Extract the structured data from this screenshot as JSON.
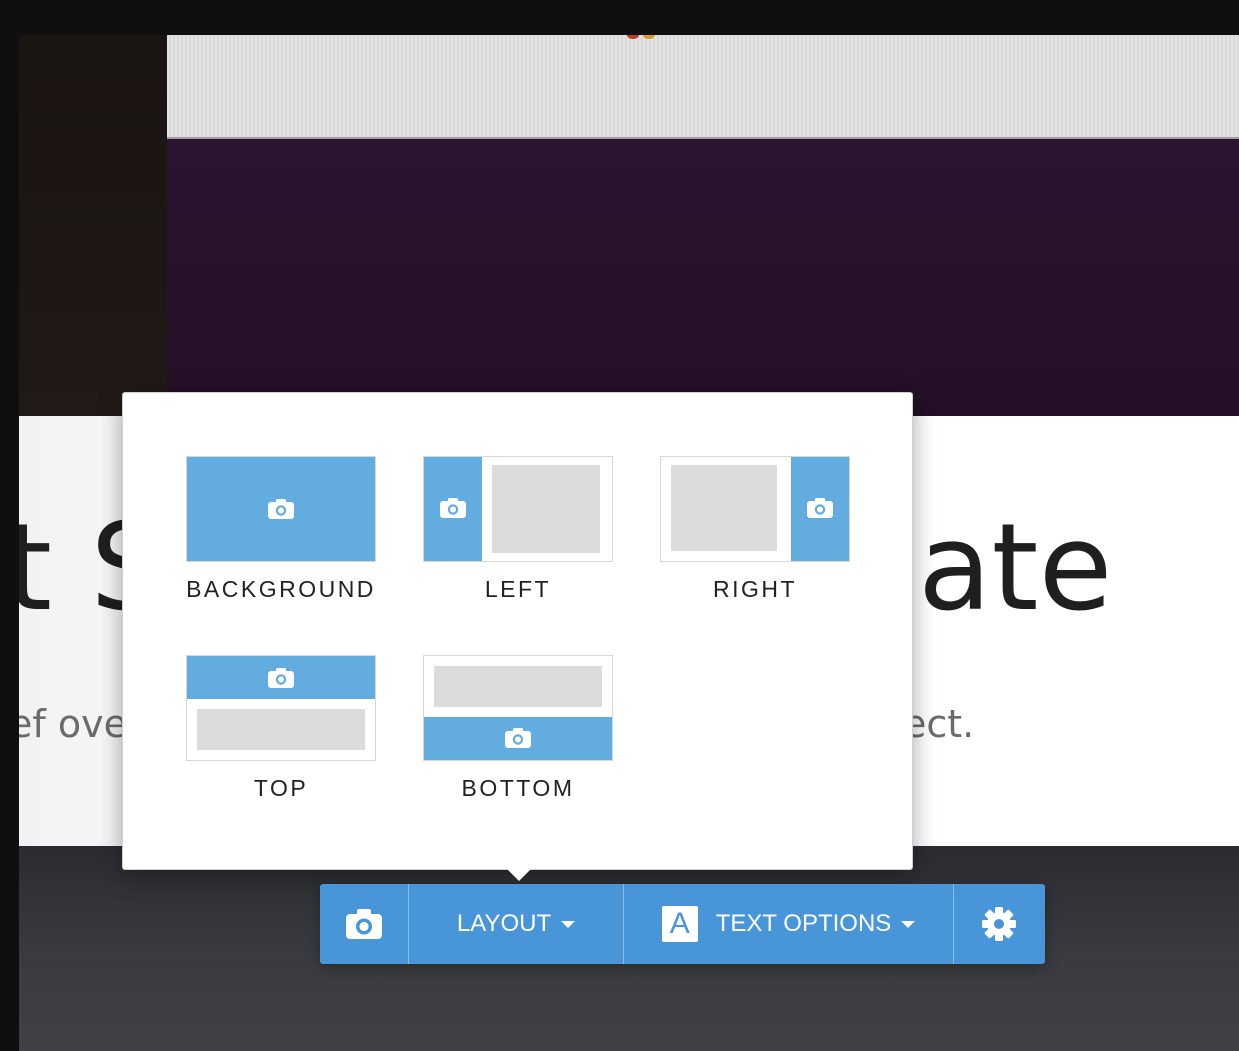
{
  "background": {
    "hero_left": "t S",
    "hero_right": "ate",
    "sub_left": "ef ove",
    "sub_right": "ect."
  },
  "layout_popup": {
    "options": [
      {
        "label": "BACKGROUND",
        "icon": "camera-icon"
      },
      {
        "label": "LEFT",
        "icon": "camera-icon"
      },
      {
        "label": "RIGHT",
        "icon": "camera-icon"
      },
      {
        "label": "TOP",
        "icon": "camera-icon"
      },
      {
        "label": "BOTTOM",
        "icon": "camera-icon"
      }
    ]
  },
  "toolbar": {
    "photo_icon": "camera-icon",
    "layout_label": "LAYOUT",
    "text_options_icon_letter": "A",
    "text_options_label": "TEXT OPTIONS",
    "settings_icon": "gear-icon"
  },
  "colors": {
    "accent_blue": "#4895d8",
    "thumb_blue": "#62ace0",
    "thumb_gray": "#dcdcdc"
  }
}
